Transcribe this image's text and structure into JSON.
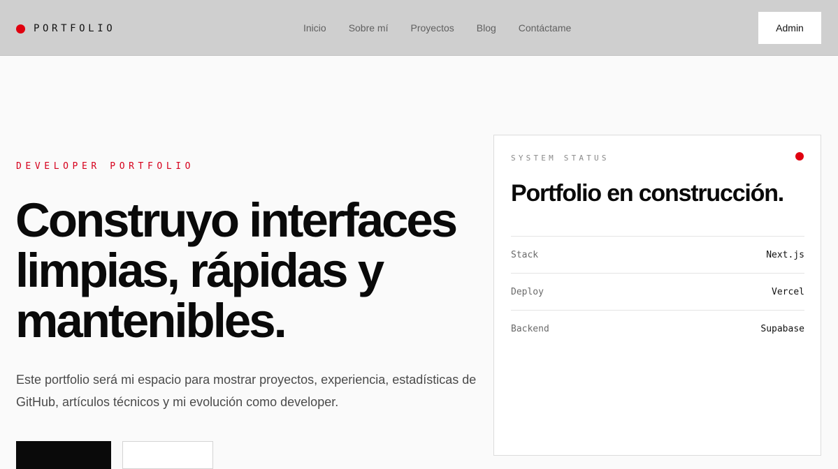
{
  "header": {
    "brand": "PORTFOLIO",
    "nav": [
      "Inicio",
      "Sobre mí",
      "Proyectos",
      "Blog",
      "Contáctame"
    ],
    "admin_label": "Admin",
    "brand_dot_color": "#e0000f"
  },
  "hero": {
    "eyebrow": "DEVELOPER PORTFOLIO",
    "headline": "Construyo interfaces limpias, rápidas y mantenibles.",
    "lead": "Este portfolio será mi espacio para mostrar proyectos, experiencia, estadísticas de GitHub, artículos técnicos y mi evolución como developer.",
    "accent_color": "#d6001c"
  },
  "status_card": {
    "label": "SYSTEM STATUS",
    "title": "Portfolio en construcción.",
    "rows": [
      {
        "key": "Stack",
        "value": "Next.js"
      },
      {
        "key": "Deploy",
        "value": "Vercel"
      },
      {
        "key": "Backend",
        "value": "Supabase"
      }
    ]
  }
}
